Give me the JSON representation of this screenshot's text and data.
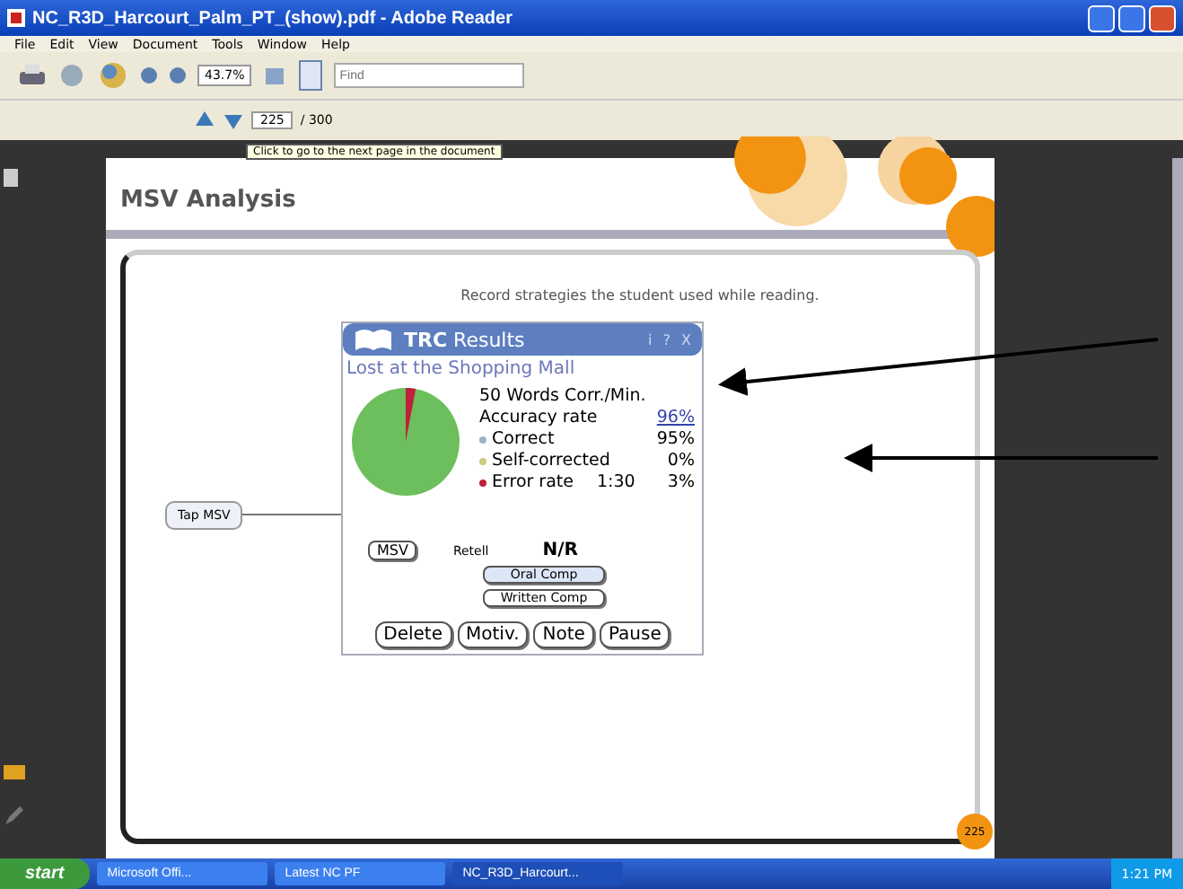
{
  "window": {
    "title": "NC_R3D_Harcourt_Palm_PT_(show).pdf - Adobe Reader"
  },
  "menu": [
    "File",
    "Edit",
    "View",
    "Document",
    "Tools",
    "Window",
    "Help"
  ],
  "toolbar": {
    "zoom": "43.7%",
    "find_placeholder": "Find"
  },
  "navigation": {
    "page": "225",
    "total": "/ 300",
    "tooltip": "Click to go to the next page in the document"
  },
  "document": {
    "heading": "MSV Analysis",
    "instruction": "Record strategies the student used while reading.",
    "trc": {
      "title_bold": "TRC",
      "title": "Results",
      "header_buttons": [
        "i",
        "?",
        "X"
      ],
      "story": "Lost at the Shopping Mall",
      "stats": [
        {
          "kind": "plain",
          "label": "50 Words Corr./Min."
        },
        {
          "kind": "link",
          "label": "Accuracy rate",
          "value": "96%"
        },
        {
          "kind": "dot",
          "label": "Correct",
          "value": "95%",
          "color": "#9fb3bd"
        },
        {
          "kind": "dot",
          "label": "Self-corrected",
          "value": "0%",
          "color": "#c9cd7c"
        },
        {
          "kind": "dot",
          "label": "Error rate",
          "extra": "1:30",
          "value": "3%",
          "color": "#c0203c"
        }
      ],
      "callout": "Tap MSV",
      "msv_button": "MSV",
      "retell_label": "Retell",
      "retell_value": "N/R",
      "comp_buttons": [
        {
          "label": "Oral Comp",
          "selected": true
        },
        {
          "label": "Written Comp",
          "selected": false
        }
      ],
      "footer_buttons": [
        "Delete",
        "Motiv.",
        "Note",
        "Pause"
      ]
    },
    "page_badge": "225"
  },
  "taskbar": {
    "start": "start",
    "tasks": [
      {
        "label": "Microsoft Offi...",
        "selected": false
      },
      {
        "label": "Latest NC PF",
        "selected": false
      },
      {
        "label": "NC_R3D_Harcourt...",
        "selected": true
      }
    ],
    "clock": "1:21 PM"
  }
}
